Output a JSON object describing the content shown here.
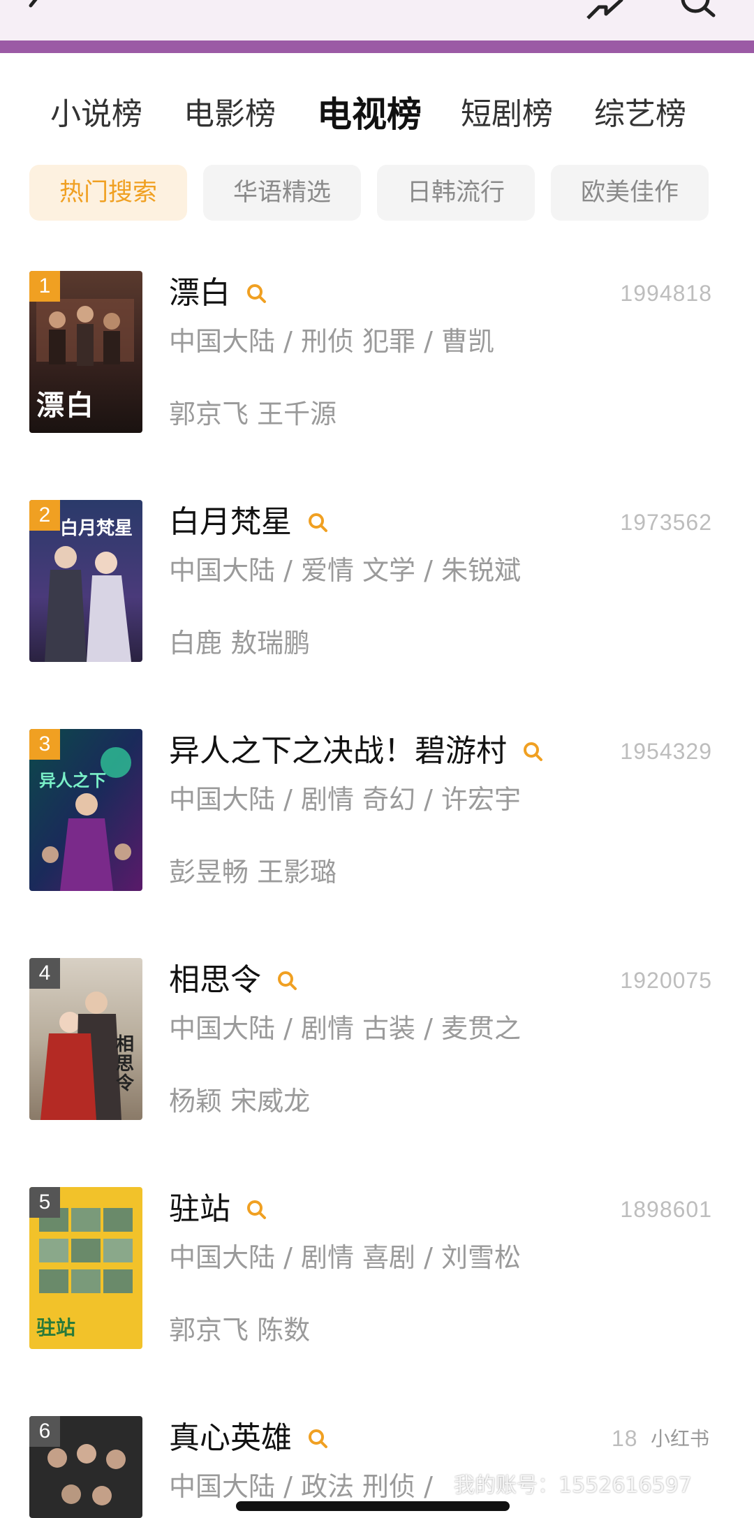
{
  "header": {
    "back_icon": "chevron-left-icon",
    "share_icon": "share-icon",
    "search_icon": "search-icon",
    "accent_color": "#9b5aa5"
  },
  "category_tabs": [
    "小说榜",
    "电影榜",
    "电视榜",
    "短剧榜",
    "综艺榜"
  ],
  "active_category": "电视榜",
  "filters": [
    "热门搜索",
    "华语精选",
    "日韩流行",
    "欧美佳作"
  ],
  "active_filter": "热门搜索",
  "colors": {
    "active_chip_text": "#f0a022",
    "active_chip_bg": "#fdf1e0",
    "title_search_icon": "#f0a022",
    "badge_top3": "#f0a022",
    "badge_other": "#555555"
  },
  "rankings": [
    {
      "rank": "1",
      "title": "漂白",
      "score": "1994818",
      "meta": "中国大陆 / 刑侦 犯罪 / 曹凯",
      "cast": "郭京飞 王千源",
      "poster_text": "漂白"
    },
    {
      "rank": "2",
      "title": "白月梵星",
      "score": "1973562",
      "meta": "中国大陆 / 爱情 文学 / 朱锐斌",
      "cast": "白鹿 敖瑞鹏",
      "poster_text": "白月梵星"
    },
    {
      "rank": "3",
      "title": "异人之下之决战！碧游村",
      "score": "1954329",
      "meta": "中国大陆 / 剧情 奇幻 / 许宏宇",
      "cast": "彭昱畅 王影璐",
      "poster_text": "异人之下"
    },
    {
      "rank": "4",
      "title": "相思令",
      "score": "1920075",
      "meta": "中国大陆 / 剧情 古装 / 麦贯之",
      "cast": "杨颖 宋威龙",
      "poster_text": "相思令"
    },
    {
      "rank": "5",
      "title": "驻站",
      "score": "1898601",
      "meta": "中国大陆 / 剧情 喜剧 / 刘雪松",
      "cast": "郭京飞 陈数",
      "poster_text": "驻站"
    },
    {
      "rank": "6",
      "title": "真心英雄",
      "score": "18",
      "meta": "中国大陆 / 政法 刑侦 / ",
      "cast": "",
      "poster_text": ""
    }
  ],
  "watermark": {
    "badge": "小红书",
    "text": "我的账号：1552616597"
  }
}
